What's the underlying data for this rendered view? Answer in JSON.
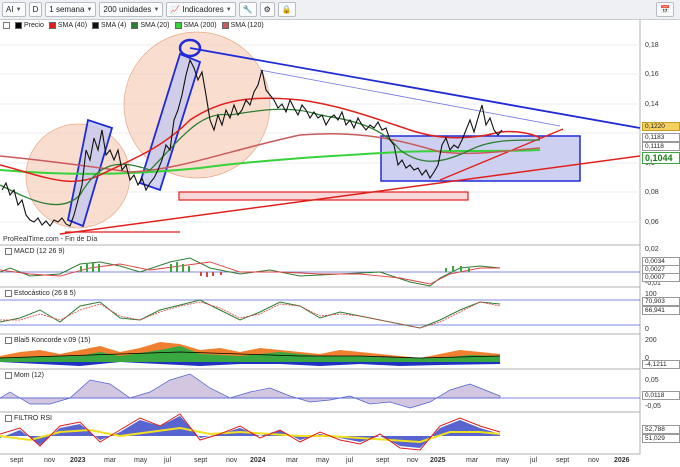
{
  "toolbar": {
    "symbol": "AI",
    "mode": "D",
    "period": "1 semana",
    "units": "200 unidades",
    "indicators": "Indicadores"
  },
  "legend": [
    {
      "label": "Precio",
      "color": "#000000"
    },
    {
      "label": "SMA (40)",
      "color": "#e0201a"
    },
    {
      "label": "SMA (4)",
      "color": "#111111"
    },
    {
      "label": "SMA (20)",
      "color": "#2e7d32"
    },
    {
      "label": "SMA (200)",
      "color": "#37d23a"
    },
    {
      "label": "SMA (120)",
      "color": "#c85a5a"
    }
  ],
  "source_text": "ProRealTime.com - Fin de Día",
  "price_axis": {
    "ticks": [
      "0,18",
      "0,16",
      "0,14",
      "0,12",
      "0,1",
      "0,08",
      "0,06"
    ]
  },
  "price_badges": {
    "top": "0,1220",
    "mid1": "0,1183",
    "mid2": "0,1118",
    "last": "0,1044"
  },
  "panels": {
    "macd": {
      "title": "MACD (12 26 9)",
      "ticks": [
        "0,02",
        "0",
        "-0,01"
      ],
      "badges": [
        "0,0034",
        "0,0027",
        "0,0007"
      ]
    },
    "stoch": {
      "title": "Estocástico (26 8 5)",
      "ticks": [
        "100",
        "0"
      ],
      "badges": [
        "70,903",
        "66,941"
      ]
    },
    "blai": {
      "title": "Blai5 Koncorde v.09 (15)",
      "ticks": [
        "200",
        "0"
      ],
      "badges": [
        "-4,1211"
      ]
    },
    "mom": {
      "title": "Mom (12)",
      "ticks": [
        "0,05",
        "0",
        "-0,05"
      ],
      "badges": [
        "0,0118"
      ]
    },
    "rsi": {
      "title": "FILTRO RSI",
      "ticks": [],
      "badges": [
        "52,788",
        "51,029"
      ]
    }
  },
  "x_axis": [
    "sept",
    "nov",
    "2023",
    "mar",
    "may",
    "jul",
    "sept",
    "nov",
    "2024",
    "mar",
    "may",
    "jul",
    "sept",
    "nov",
    "2025",
    "mar",
    "may",
    "jul",
    "sept",
    "nov",
    "2026"
  ],
  "colors": {
    "accent_blue": "#1f2bd6",
    "red": "#e0201a",
    "green": "#37d23a",
    "peach": "#f5c8b0",
    "box_fill": "#c5c8ee"
  }
}
